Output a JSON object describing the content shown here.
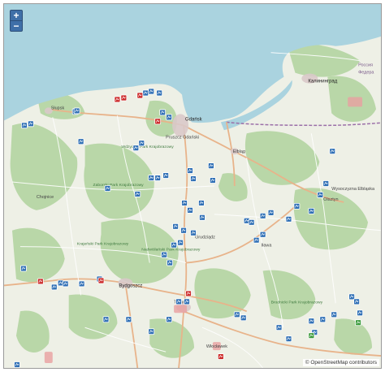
{
  "zoom": {
    "in_label": "+",
    "out_label": "−"
  },
  "attribution": "© OpenStreetMap contributors",
  "places": {
    "kaliningrad": "Калининград",
    "gdansk": "Gdańsk",
    "pruszcz": "Pruszcz Gdański",
    "elblag": "Elbląg",
    "slupsk": "Słupsk",
    "bydgoszcz": "Bydgoszcz",
    "russia": "Россия",
    "federacia": "Федера",
    "zaborski": "Zaborski Park Krajobrazowy",
    "wdzydzki": "Wdzydzki Park Krajobrazowy",
    "nadwislanski": "Nadwiślański Park Krajobrazowy",
    "wysoczyzna": "Wysoczyzna Elbląska",
    "olsztyn": "Olsztyn",
    "torun": "Toruń",
    "wloclawek": "Włocławek",
    "ilawa": "Iława",
    "grudziadz": "Grudziądz",
    "chojnice": "Chojnice",
    "krajenski": "Krajeński Park Krajobrazowy",
    "brodnicki": "Brodnicki Park Krajobrazowy"
  },
  "colors": {
    "sea": "#aad3df",
    "land": "#eef0e6",
    "forest": "#add19e",
    "road_major": "#e8b38a",
    "road_minor": "#ffffff",
    "marker_blue": "#2f6fb5",
    "marker_red": "#cc2a2a",
    "marker_green": "#3c9b3c",
    "border": "#9b6fa8"
  },
  "markers": {
    "blue_count": 68,
    "red_count": 8,
    "green_count": 2
  }
}
